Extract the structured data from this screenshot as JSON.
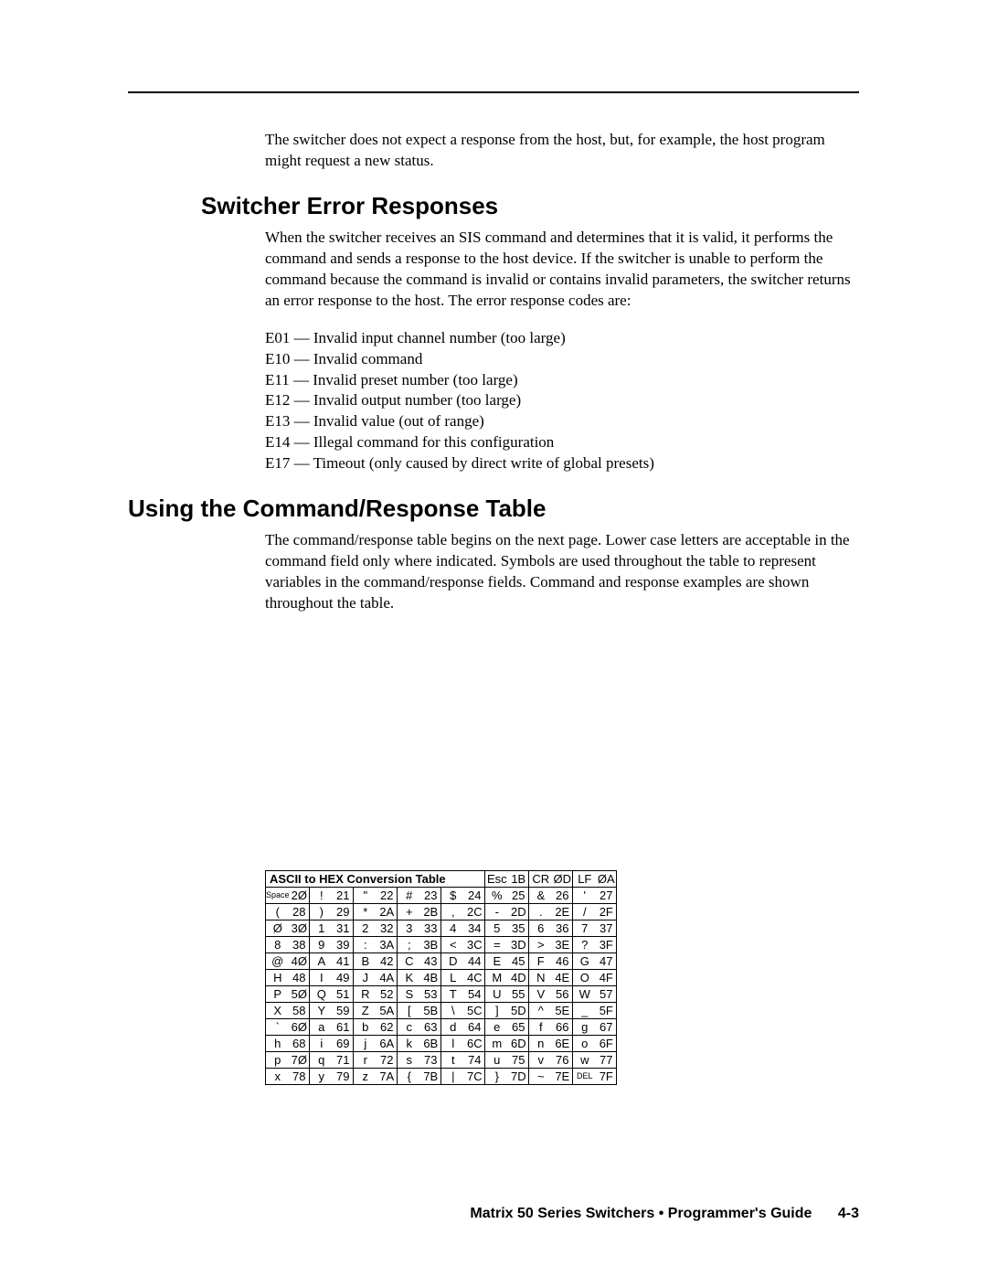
{
  "intro_para": "The switcher does not expect a response from the host, but, for example, the host program might request a new status.",
  "h_err": "Switcher Error Responses",
  "err_para": "When the switcher receives an SIS command and determines that it is valid, it performs the command and sends a response to the host device.  If the switcher is unable to perform the command because the command is invalid or contains invalid parameters, the switcher returns an error response to the host.  The error response codes are:",
  "errs": [
    "E01 — Invalid input channel number (too large)",
    "E10 — Invalid command",
    "E11 — Invalid preset number (too large)",
    "E12 — Invalid output number (too large)",
    "E13 — Invalid value (out of range)",
    "E14 — Illegal command for this configuration",
    "E17 — Timeout (only caused by direct write of global presets)"
  ],
  "h_cmd": "Using the Command/Response Table",
  "cmd_para": "The command/response table begins on the next page.  Lower case letters are acceptable in the command field only where indicated.  Symbols are used throughout the table to represent variables in the command/response fields.  Command and response examples are shown throughout the table.",
  "ascii": {
    "title": "ASCII to HEX  Conversion Table",
    "specials": [
      {
        "c": "Esc",
        "h": "1B"
      },
      {
        "c": "CR",
        "h": "ØD"
      },
      {
        "c": "LF",
        "h": "ØA"
      }
    ],
    "rows": [
      [
        {
          "c": "Space",
          "h": "2Ø",
          "sm": true
        },
        {
          "c": "!",
          "h": "21"
        },
        {
          "c": "\"",
          "h": "22"
        },
        {
          "c": "#",
          "h": "23"
        },
        {
          "c": "$",
          "h": "24"
        },
        {
          "c": "%",
          "h": "25"
        },
        {
          "c": "&",
          "h": "26"
        },
        {
          "c": "'",
          "h": "27"
        }
      ],
      [
        {
          "c": "(",
          "h": "28"
        },
        {
          "c": ")",
          "h": "29"
        },
        {
          "c": "*",
          "h": "2A"
        },
        {
          "c": "+",
          "h": "2B"
        },
        {
          "c": ",",
          "h": "2C"
        },
        {
          "c": "-",
          "h": "2D"
        },
        {
          "c": ".",
          "h": "2E"
        },
        {
          "c": "/",
          "h": "2F"
        }
      ],
      [
        {
          "c": "Ø",
          "h": "3Ø"
        },
        {
          "c": "1",
          "h": "31"
        },
        {
          "c": "2",
          "h": "32"
        },
        {
          "c": "3",
          "h": "33"
        },
        {
          "c": "4",
          "h": "34"
        },
        {
          "c": "5",
          "h": "35"
        },
        {
          "c": "6",
          "h": "36"
        },
        {
          "c": "7",
          "h": "37"
        }
      ],
      [
        {
          "c": "8",
          "h": "38"
        },
        {
          "c": "9",
          "h": "39"
        },
        {
          "c": ":",
          "h": "3A"
        },
        {
          "c": ";",
          "h": "3B"
        },
        {
          "c": "<",
          "h": "3C"
        },
        {
          "c": "=",
          "h": "3D"
        },
        {
          "c": ">",
          "h": "3E"
        },
        {
          "c": "?",
          "h": "3F"
        }
      ],
      [
        {
          "c": "@",
          "h": "4Ø"
        },
        {
          "c": "A",
          "h": "41"
        },
        {
          "c": "B",
          "h": "42"
        },
        {
          "c": "C",
          "h": "43"
        },
        {
          "c": "D",
          "h": "44"
        },
        {
          "c": "E",
          "h": "45"
        },
        {
          "c": "F",
          "h": "46"
        },
        {
          "c": "G",
          "h": "47"
        }
      ],
      [
        {
          "c": "H",
          "h": "48"
        },
        {
          "c": "I",
          "h": "49"
        },
        {
          "c": "J",
          "h": "4A"
        },
        {
          "c": "K",
          "h": "4B"
        },
        {
          "c": "L",
          "h": "4C"
        },
        {
          "c": "M",
          "h": "4D"
        },
        {
          "c": "N",
          "h": "4E"
        },
        {
          "c": "O",
          "h": "4F"
        }
      ],
      [
        {
          "c": "P",
          "h": "5Ø"
        },
        {
          "c": "Q",
          "h": "51"
        },
        {
          "c": "R",
          "h": "52"
        },
        {
          "c": "S",
          "h": "53"
        },
        {
          "c": "T",
          "h": "54"
        },
        {
          "c": "U",
          "h": "55"
        },
        {
          "c": "V",
          "h": "56"
        },
        {
          "c": "W",
          "h": "57"
        }
      ],
      [
        {
          "c": "X",
          "h": "58"
        },
        {
          "c": "Y",
          "h": "59"
        },
        {
          "c": "Z",
          "h": "5A"
        },
        {
          "c": "[",
          "h": "5B"
        },
        {
          "c": "\\",
          "h": "5C"
        },
        {
          "c": "]",
          "h": "5D"
        },
        {
          "c": "^",
          "h": "5E"
        },
        {
          "c": "_",
          "h": "5F"
        }
      ],
      [
        {
          "c": "`",
          "h": "6Ø"
        },
        {
          "c": "a",
          "h": "61"
        },
        {
          "c": "b",
          "h": "62"
        },
        {
          "c": "c",
          "h": "63"
        },
        {
          "c": "d",
          "h": "64"
        },
        {
          "c": "e",
          "h": "65"
        },
        {
          "c": "f",
          "h": "66"
        },
        {
          "c": "g",
          "h": "67"
        }
      ],
      [
        {
          "c": "h",
          "h": "68"
        },
        {
          "c": "i",
          "h": "69"
        },
        {
          "c": "j",
          "h": "6A"
        },
        {
          "c": "k",
          "h": "6B"
        },
        {
          "c": "l",
          "h": "6C"
        },
        {
          "c": "m",
          "h": "6D"
        },
        {
          "c": "n",
          "h": "6E"
        },
        {
          "c": "o",
          "h": "6F"
        }
      ],
      [
        {
          "c": "p",
          "h": "7Ø"
        },
        {
          "c": "q",
          "h": "71"
        },
        {
          "c": "r",
          "h": "72"
        },
        {
          "c": "s",
          "h": "73"
        },
        {
          "c": "t",
          "h": "74"
        },
        {
          "c": "u",
          "h": "75"
        },
        {
          "c": "v",
          "h": "76"
        },
        {
          "c": "w",
          "h": "77"
        }
      ],
      [
        {
          "c": "x",
          "h": "78"
        },
        {
          "c": "y",
          "h": "79"
        },
        {
          "c": "z",
          "h": "7A"
        },
        {
          "c": "{",
          "h": "7B"
        },
        {
          "c": "|",
          "h": "7C"
        },
        {
          "c": "}",
          "h": "7D"
        },
        {
          "c": "~",
          "h": "7E"
        },
        {
          "c": "DEL",
          "h": "7F",
          "sm": true
        }
      ]
    ]
  },
  "footer_title": "Matrix 50 Series Switchers • Programmer's Guide",
  "footer_page": "4-3"
}
